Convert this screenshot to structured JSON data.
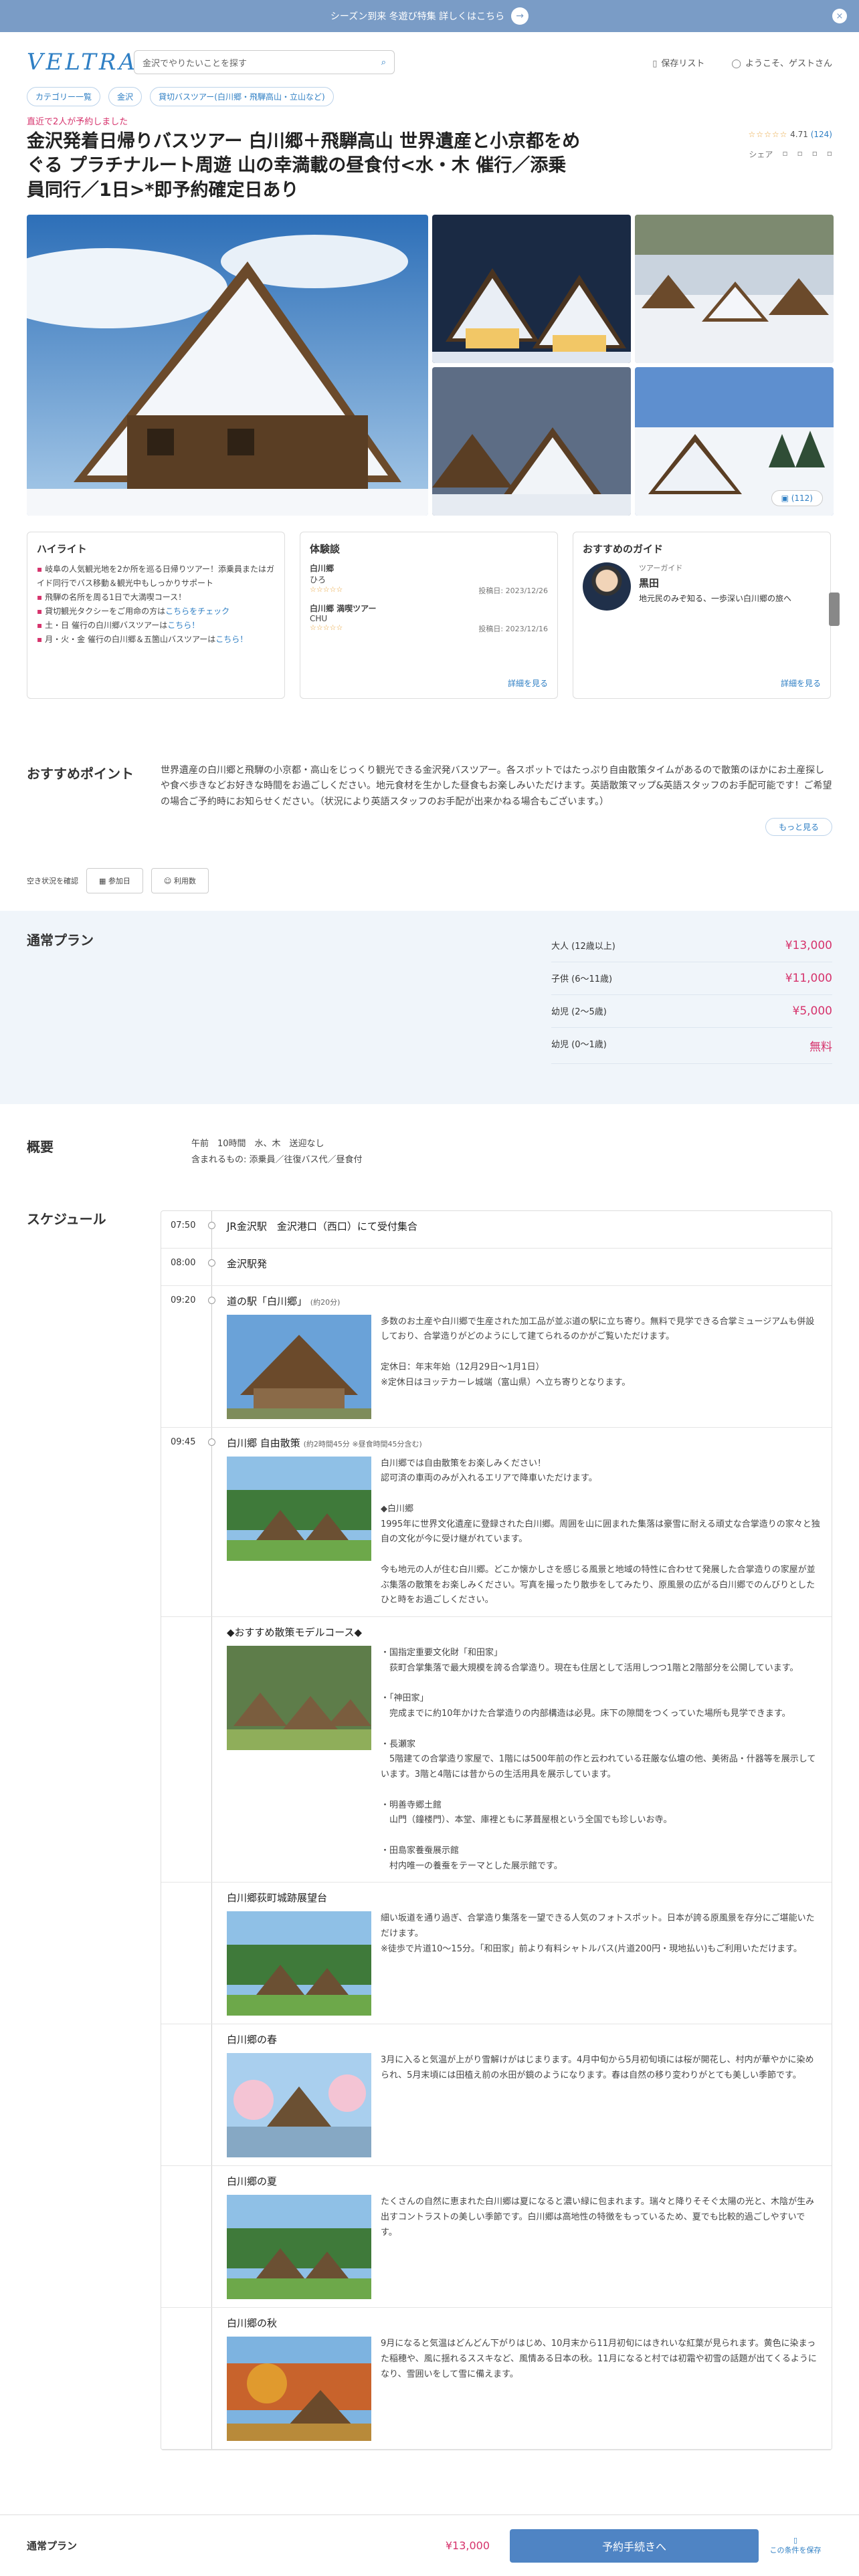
{
  "banner": {
    "text": "シーズン到来 冬遊び特集 詳しくはこちら",
    "arrow": "→",
    "close": "×"
  },
  "header": {
    "logo": "VELTRA",
    "search_placeholder": "金沢でやりたいことを探す",
    "saved": "保存リスト",
    "welcome": "ようこそ、ゲストさん"
  },
  "breadcrumb": [
    "カテゴリー一覧",
    "金沢",
    "貸切バスツアー(白川郷・飛騨高山・立山など)"
  ],
  "booked_notice": "直近で2人が予約しました",
  "title": "金沢発着日帰りバスツアー 白川郷＋飛騨高山 世界遺産と小京都をめぐる プラチナルート周遊 山の幸満載の昼食付<水・木 催行／添乗員同行／1日>*即予約確定日あり",
  "rating": {
    "stars": "☆☆☆☆☆",
    "score": "4.71",
    "count": "(124)",
    "share": "シェア"
  },
  "gallery": {
    "photo_count": "(112)"
  },
  "highlights": {
    "heading": "ハイライト",
    "items": [
      {
        "text": "岐阜の人気観光地を2か所を巡る日帰りツアー！添乗員またはガイド同行でバス移動＆観光中もしっかりサポート",
        "link": ""
      },
      {
        "text": "飛騨の名所を周る1日で大満喫コース！",
        "link": ""
      },
      {
        "text": "貸切観光タクシーをご用命の方は",
        "link": "こちらをチェック"
      },
      {
        "text": "土・日 催行の白川郷バスツアーは",
        "link": "こちら！"
      },
      {
        "text": "月・火・金 催行の白川郷＆五箇山バスツアーは",
        "link": "こちら！"
      }
    ]
  },
  "reviews": {
    "heading": "体験談",
    "items": [
      {
        "title": "白川郷",
        "author": "ひろ",
        "stars": "☆☆☆☆☆",
        "date": "投稿日: 2023/12/26"
      },
      {
        "title": "白川郷 満喫ツアー",
        "author": "CHU",
        "stars": "☆☆☆☆☆",
        "date": "投稿日: 2023/12/16"
      }
    ],
    "more": "詳細を見る"
  },
  "guide": {
    "heading": "おすすめのガイド",
    "role": "ツアーガイド",
    "name": "黒田",
    "text": "地元民のみぞ知る、一歩深い白川郷の旅へ",
    "more": "詳細を見る"
  },
  "points": {
    "heading": "おすすめポイント",
    "text": "世界遺産の白川郷と飛騨の小京都・高山をじっくり観光できる金沢発バスツアー。各スポットではたっぷり自由散策タイムがあるので散策のほかにお土産探しや食べ歩きなどお好きな時間をお過ごしください。地元食材を生かした昼食もお楽しみいただけます。英語散策マップ&英語スタッフのお手配可能です！ご希望の場合ご予約時にお知らせください。（状況により英語スタッフのお手配が出来かねる場合もございます。）",
    "more": "もっと見る"
  },
  "availability": {
    "label": "空き状況を確認",
    "date_btn": "参加日",
    "people_btn": "利用数"
  },
  "plans": {
    "heading": "通常プラン",
    "rows": [
      {
        "label": "大人 (12歳以上)",
        "price": "¥13,000"
      },
      {
        "label": "子供 (6～11歳)",
        "price": "¥11,000"
      },
      {
        "label": "幼児 (2～5歳)",
        "price": "¥5,000"
      },
      {
        "label": "幼児 (0～1歳)",
        "price": "無料"
      }
    ]
  },
  "overview": {
    "heading": "概要",
    "line1": "午前　10時間　水、木　送迎なし",
    "line2": "含まれるもの: 添乗員／往復バス代／昼食付"
  },
  "schedule": {
    "heading": "スケジュール",
    "items": [
      {
        "time": "07:50",
        "title": "JR金沢駅　金沢港口（西口）にて受付集合",
        "sub": "",
        "desc": "",
        "photo": ""
      },
      {
        "time": "08:00",
        "title": "金沢駅発",
        "sub": "",
        "desc": "",
        "photo": ""
      },
      {
        "time": "09:20",
        "title": "道の駅「白川郷」",
        "sub": "(約20分)",
        "desc": "多数のお土産や白川郷で生産された加工品が並ぶ道の駅に立ち寄り。無料で見学できる合掌ミュージアムも併設しており、合掌造りがどのようにして建てられるのかがご覧いただけます。\n\n定休日：年末年始（12月29日〜1月1日）\n※定休日はヨッテカーレ城端（富山県）へ立ち寄りとなります。",
        "photo": "museum"
      },
      {
        "time": "09:45",
        "title": "白川郷 自由散策",
        "sub": "(約2時間45分 ※昼食時間45分含む)",
        "desc": "白川郷では自由散策をお楽しみください！\n認可済の車両のみが入れるエリアで降車いただけます。\n\n◆白川郷\n1995年に世界文化遺産に登録された白川郷。周囲を山に囲まれた集落は豪雪に耐える頑丈な合掌造りの家々と独自の文化が今に受け継がれています。\n\n今も地元の人が住む白川郷。どこか懐かしさを感じる風景と地域の特性に合わせて発展した合掌造りの家屋が並ぶ集落の散策をお楽しみください。写真を撮ったり散歩をしてみたり、原風景の広がる白川郷でのんびりとしたひと時をお過ごしください。",
        "photo": "summer"
      },
      {
        "time": "",
        "title": "◆おすすめ散策モデルコース◆",
        "sub": "",
        "desc": "・国指定重要文化財「和田家」\n　荻町合掌集落で最大規模を誇る合掌造り。現在も住居として活用しつつ1階と2階部分を公開しています。\n\n・「神田家」\n　完成までに約10年かけた合掌造りの内部構造は必見。床下の隙間をつくっていた場所も見学できます。\n\n・長瀬家\n　5階建ての合掌造り家屋で、1階には500年前の作と云われている荘厳な仏壇の他、美術品・什器等を展示しています。3階と4階には昔からの生活用具を展示しています。\n\n・明善寺郷土館\n　山門（鐘楼門）、本堂、庫裡ともに茅葺屋根という全国でも珍しいお寺。\n\n・田島家養蚕展示館\n　村内唯一の養蚕をテーマとした展示館です。",
        "photo": "village"
      },
      {
        "time": "",
        "title": "白川郷荻町城跡展望台",
        "sub": "",
        "desc": "細い坂道を通り過ぎ、合掌造り集落を一望できる人気のフォトスポット。日本が誇る原風景を存分にご堪能いただけます。\n※徒歩で片道10〜15分。「和田家」前より有料シャトルバス(片道200円・現地払い)もご利用いただけます。",
        "photo": "summer"
      },
      {
        "time": "",
        "title": "白川郷の春",
        "sub": "",
        "desc": "3月に入ると気温が上がり雪解けがはじまります。4月中旬から5月初旬頃には桜が開花し、村内が華やかに染められ、5月末頃には田植え前の水田が鏡のようになります。春は自然の移り変わりがとても美しい季節です。",
        "photo": "spring"
      },
      {
        "time": "",
        "title": "白川郷の夏",
        "sub": "",
        "desc": "たくさんの自然に恵まれた白川郷は夏になると濃い緑に包まれます。瑞々と降りそそぐ太陽の光と、木陰が生み出すコントラストの美しい季節です。白川郷は高地性の特徴をもっているため、夏でも比較的過ごしやすいです。",
        "photo": "summer"
      },
      {
        "time": "",
        "title": "白川郷の秋",
        "sub": "",
        "desc": "9月になると気温はどんどん下がりはじめ、10月末から11月初旬にはきれいな紅葉が見られます。黄色に染まった稲穂や、風に揺れるススキなど、風情ある日本の秋。11月になると村では初霜や初雪の話題が出てくるようになり、雪囲いをして雪に備えます。",
        "photo": "autumn"
      }
    ]
  },
  "footer": {
    "plan": "通常プラン",
    "price": "¥13,000",
    "cta": "予約手続きへ",
    "save": "この条件を保存"
  }
}
